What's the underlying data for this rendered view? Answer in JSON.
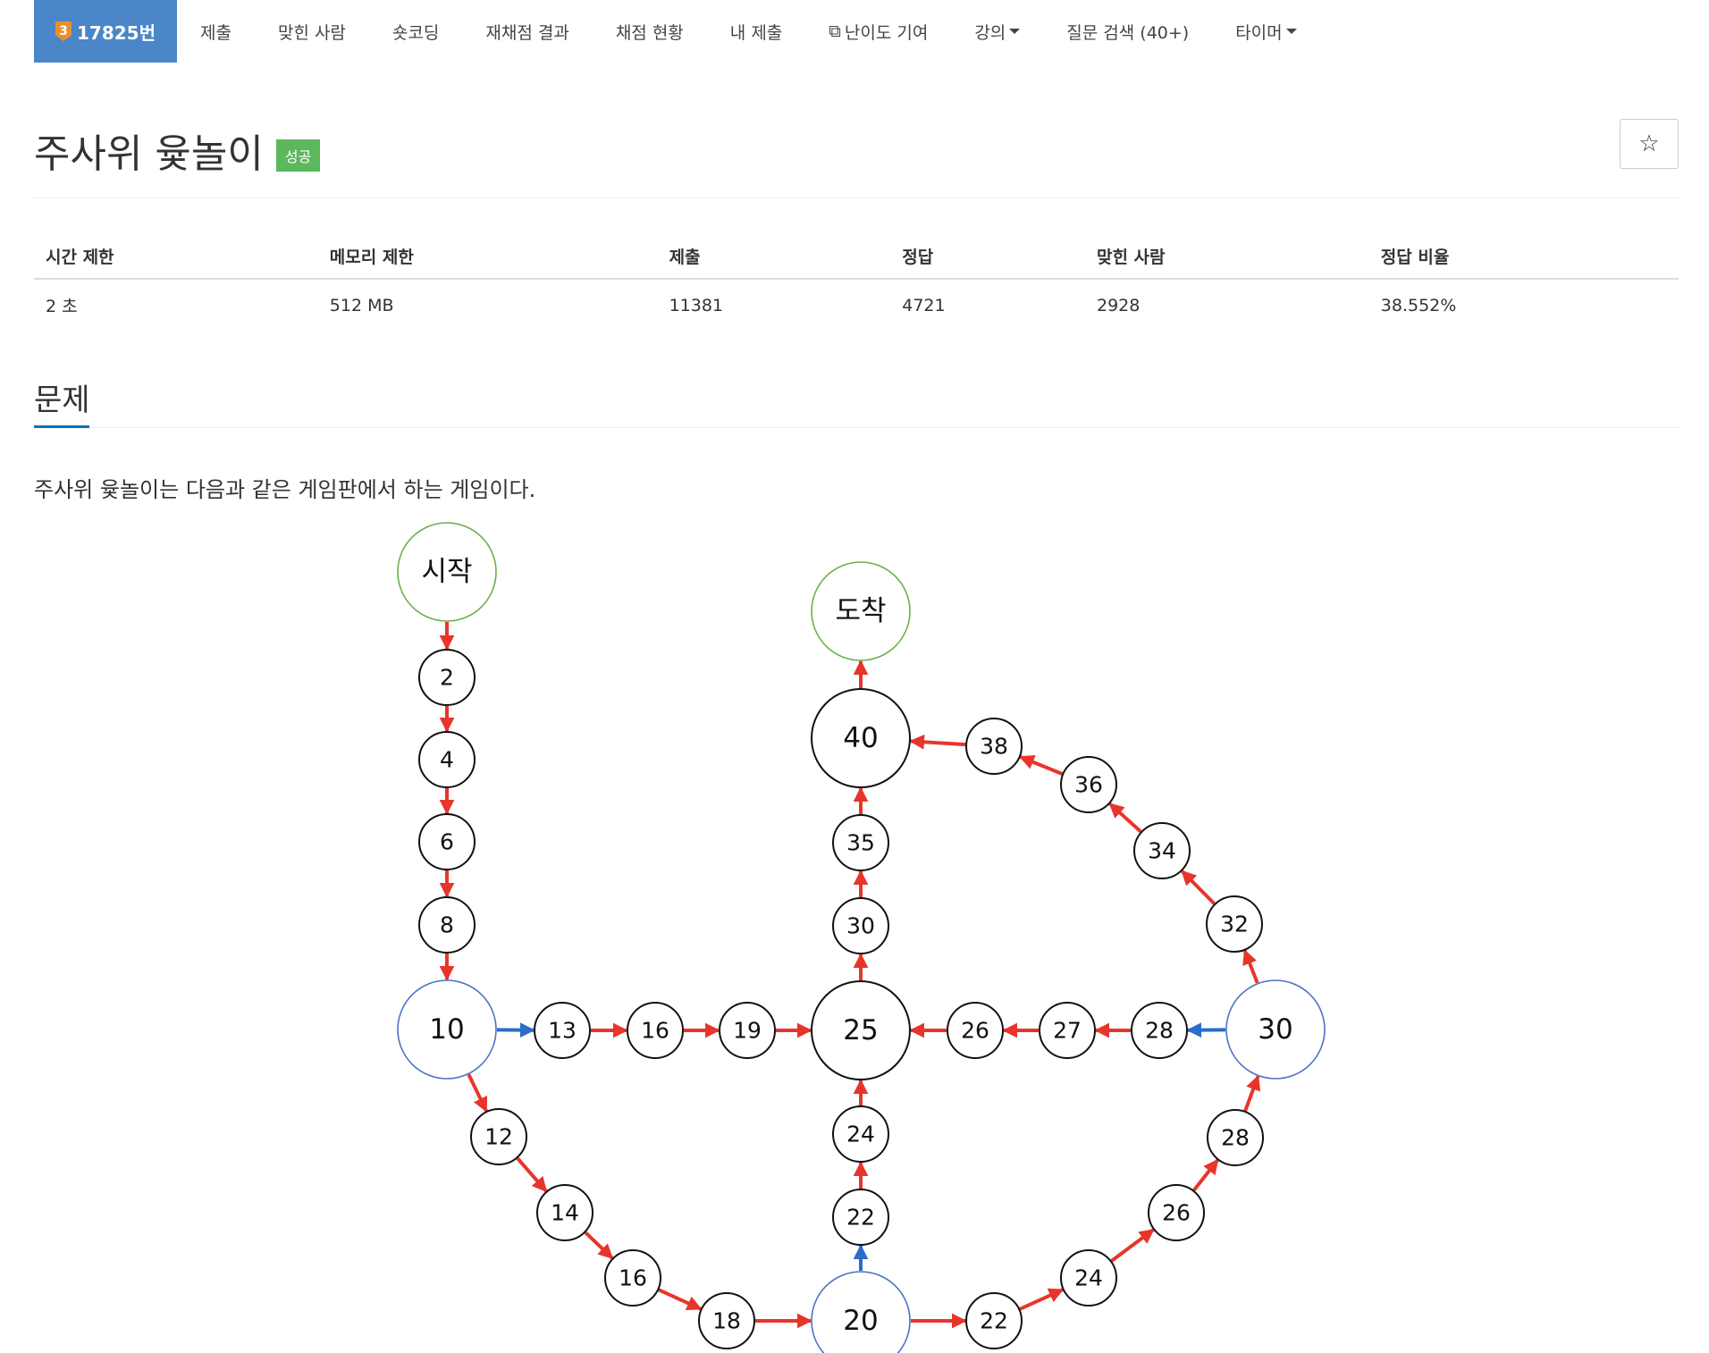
{
  "nav": {
    "problem_number": "17825번",
    "tier": "3",
    "items": [
      {
        "label": "제출",
        "name": "nav-submit"
      },
      {
        "label": "맞힌 사람",
        "name": "nav-solved-users"
      },
      {
        "label": "숏코딩",
        "name": "nav-short-coding"
      },
      {
        "label": "재채점 결과",
        "name": "nav-rejudge-results"
      },
      {
        "label": "채점 현황",
        "name": "nav-judge-status"
      },
      {
        "label": "내 제출",
        "name": "nav-my-submissions"
      },
      {
        "label": "난이도 기여",
        "name": "nav-difficulty-contribution",
        "icon": "external-link-icon"
      },
      {
        "label": "강의",
        "name": "nav-lecture",
        "dropdown": true
      },
      {
        "label": "질문 검색 (40+)",
        "name": "nav-question-search"
      },
      {
        "label": "타이머",
        "name": "nav-timer",
        "dropdown": true
      }
    ]
  },
  "problem": {
    "title": "주사위 윷놀이",
    "status": "성공",
    "star_icon": "star-outline-icon",
    "table": {
      "headers": [
        "시간 제한",
        "메모리 제한",
        "제출",
        "정답",
        "맞힌 사람",
        "정답 비율"
      ],
      "values": [
        "2 초",
        "512 MB",
        "11381",
        "4721",
        "2928",
        "38.552%"
      ]
    },
    "section_title": "문제",
    "description": "주사위 윷놀이는 다음과 같은 게임판에서 하는 게임이다."
  },
  "board": {
    "colors": {
      "red_arrow": "#e8352b",
      "blue_arrow": "#2a6ec6",
      "green_outline": "#6ab04c",
      "blue_outline": "#4a72c4"
    },
    "nodes": [
      {
        "id": "start",
        "label": "시작",
        "kind": "start"
      },
      {
        "id": "n2",
        "label": "2"
      },
      {
        "id": "n4",
        "label": "4"
      },
      {
        "id": "n6",
        "label": "6"
      },
      {
        "id": "n8",
        "label": "8"
      },
      {
        "id": "n10",
        "label": "10",
        "kind": "corner"
      },
      {
        "id": "n12",
        "label": "12"
      },
      {
        "id": "n14",
        "label": "14"
      },
      {
        "id": "n16a",
        "label": "16"
      },
      {
        "id": "n18",
        "label": "18"
      },
      {
        "id": "n20",
        "label": "20",
        "kind": "corner"
      },
      {
        "id": "n22a",
        "label": "22"
      },
      {
        "id": "n24a",
        "label": "24"
      },
      {
        "id": "n26a",
        "label": "26"
      },
      {
        "id": "n28a",
        "label": "28"
      },
      {
        "id": "n30",
        "label": "30",
        "kind": "corner"
      },
      {
        "id": "n32",
        "label": "32"
      },
      {
        "id": "n34",
        "label": "34"
      },
      {
        "id": "n36",
        "label": "36"
      },
      {
        "id": "n38",
        "label": "38"
      },
      {
        "id": "n40",
        "label": "40",
        "kind": "big"
      },
      {
        "id": "end",
        "label": "도착",
        "kind": "end"
      },
      {
        "id": "n13",
        "label": "13"
      },
      {
        "id": "n16b",
        "label": "16"
      },
      {
        "id": "n19",
        "label": "19"
      },
      {
        "id": "n25",
        "label": "25",
        "kind": "big"
      },
      {
        "id": "n22b",
        "label": "22"
      },
      {
        "id": "n24b",
        "label": "24"
      },
      {
        "id": "n28b",
        "label": "28"
      },
      {
        "id": "n27",
        "label": "27"
      },
      {
        "id": "n26b",
        "label": "26"
      },
      {
        "id": "n30b",
        "label": "30"
      },
      {
        "id": "n35",
        "label": "35"
      }
    ],
    "edges": [
      [
        "start",
        "n2",
        "red"
      ],
      [
        "n2",
        "n4",
        "red"
      ],
      [
        "n4",
        "n6",
        "red"
      ],
      [
        "n6",
        "n8",
        "red"
      ],
      [
        "n8",
        "n10",
        "red"
      ],
      [
        "n10",
        "n12",
        "red"
      ],
      [
        "n12",
        "n14",
        "red"
      ],
      [
        "n14",
        "n16a",
        "red"
      ],
      [
        "n16a",
        "n18",
        "red"
      ],
      [
        "n18",
        "n20",
        "red"
      ],
      [
        "n20",
        "n22a",
        "red"
      ],
      [
        "n22a",
        "n24a",
        "red"
      ],
      [
        "n24a",
        "n26a",
        "red"
      ],
      [
        "n26a",
        "n28a",
        "red"
      ],
      [
        "n28a",
        "n30",
        "red"
      ],
      [
        "n30",
        "n32",
        "red"
      ],
      [
        "n32",
        "n34",
        "red"
      ],
      [
        "n34",
        "n36",
        "red"
      ],
      [
        "n36",
        "n38",
        "red"
      ],
      [
        "n38",
        "n40",
        "red"
      ],
      [
        "n40",
        "end",
        "red"
      ],
      [
        "n10",
        "n13",
        "blue"
      ],
      [
        "n13",
        "n16b",
        "red"
      ],
      [
        "n16b",
        "n19",
        "red"
      ],
      [
        "n19",
        "n25",
        "red"
      ],
      [
        "n20",
        "n22b",
        "blue"
      ],
      [
        "n22b",
        "n24b",
        "red"
      ],
      [
        "n24b",
        "n25",
        "red"
      ],
      [
        "n30",
        "n28b",
        "blue"
      ],
      [
        "n28b",
        "n27",
        "red"
      ],
      [
        "n27",
        "n26b",
        "red"
      ],
      [
        "n26b",
        "n25",
        "red"
      ],
      [
        "n25",
        "n30b",
        "red"
      ],
      [
        "n30b",
        "n35",
        "red"
      ],
      [
        "n35",
        "n40",
        "red"
      ]
    ]
  }
}
